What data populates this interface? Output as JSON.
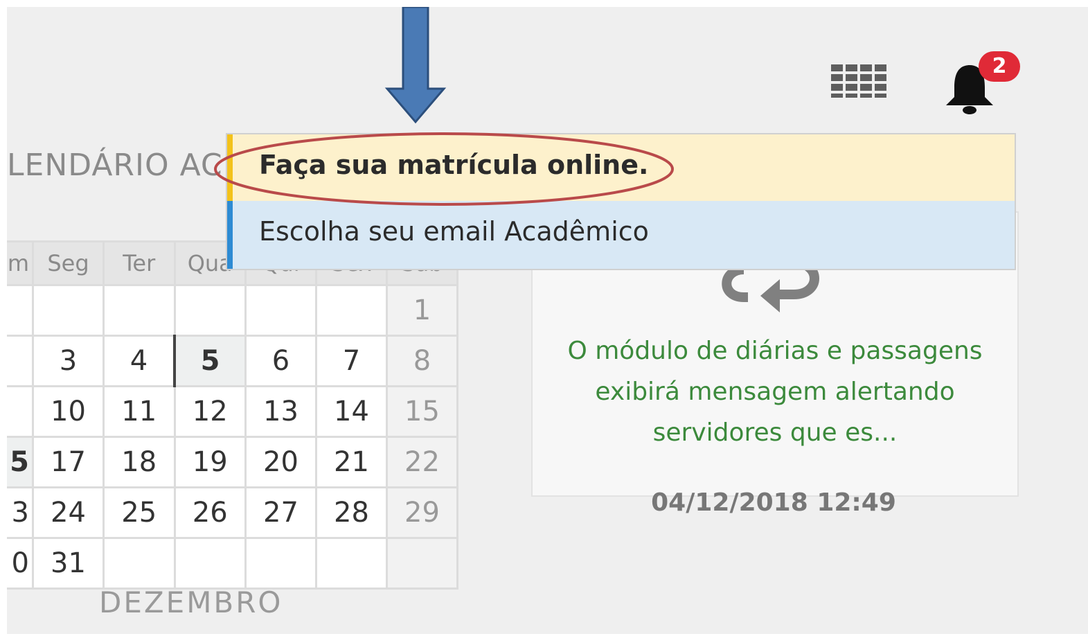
{
  "header": {
    "apps_icon": "grid-icon",
    "notifications": {
      "icon": "bell-icon",
      "count": "2",
      "badge_color": "#e02a37"
    }
  },
  "calendar": {
    "heading": "LENDÁRIO AC",
    "weekdays": [
      "m",
      "Seg",
      "Ter",
      "Qua",
      "Qui",
      "Sex",
      "Sáb"
    ],
    "rows": [
      [
        "",
        "",
        "",
        "",
        "",
        "",
        "1"
      ],
      [
        "",
        "3",
        "4",
        "5",
        "6",
        "7",
        "8"
      ],
      [
        "",
        "10",
        "11",
        "12",
        "13",
        "14",
        "15"
      ],
      [
        "5",
        "17",
        "18",
        "19",
        "20",
        "21",
        "22"
      ],
      [
        "3",
        "24",
        "25",
        "26",
        "27",
        "28",
        "29"
      ],
      [
        "0",
        "31",
        "",
        "",
        "",
        "",
        ""
      ]
    ],
    "today": "5",
    "month": "DEZEMBRO"
  },
  "news": {
    "icon": "share-arrows-icon",
    "text": "O módulo de diárias e passagens exibirá mensagem alertando servidores que es...",
    "date": "04/12/2018 12:49"
  },
  "dropdown": {
    "items": [
      {
        "label": "Faça sua matrícula online.",
        "accent": "#f3c21b"
      },
      {
        "label": "Escolha seu email Acadêmico",
        "accent": "#2d8bd3"
      }
    ]
  },
  "annotations": {
    "arrow_color": "#4a7ab5",
    "ellipse_color": "#b94a4a"
  }
}
